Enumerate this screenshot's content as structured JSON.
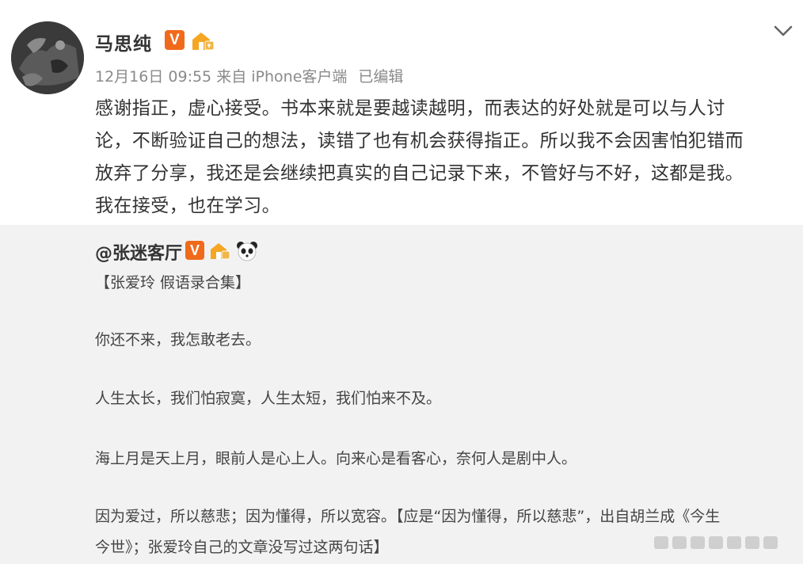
{
  "post": {
    "author": "马思纯",
    "verified_badge": "V",
    "meta": {
      "time": "12月16日 09:55",
      "source": "来自 iPhone客户端",
      "edited": "已编辑"
    },
    "body_lines": [
      "感谢指正，虚心接受。书本来就是要越读越明，而表达的好处就是可以与人讨",
      "论，不断验证自己的想法，读错了也有机会获得指正。所以我不会因害怕犯错而",
      "放弃了分享，我还是会继续把真实的自己记录下来，不管好与不好，这都是我。",
      "我在接受，也在学习。"
    ],
    "icons": {
      "menu": "chevron-down-icon",
      "badge": "verified-v-icon",
      "fan": "house-fan-icon"
    }
  },
  "quoted": {
    "author": "@张迷客厅",
    "verified_badge": "V",
    "lines": [
      "【张爱玲 假语录合集】",
      "你还不来，我怎敢老去。",
      "人生太长，我们怕寂寞，人生太短，我们怕来不及。",
      "海上月是天上月，眼前人是心上人。向来心是看客心，奈何人是剧中人。",
      "因为爱过，所以慈悲；因为懂得，所以宽容。【应是“因为懂得，所以慈悲”，出自胡兰成《今生",
      "今世》；张爱玲自己的文章没写过这两句话】"
    ],
    "icons": {
      "badge": "verified-v-icon",
      "fan": "house-fan-icon",
      "panda": "panda-icon"
    }
  },
  "colors": {
    "accent_badge": "#f06a1b",
    "quote_background": "#f2f2f2",
    "meta_text": "#8a8a8a",
    "body_text": "#333333"
  }
}
